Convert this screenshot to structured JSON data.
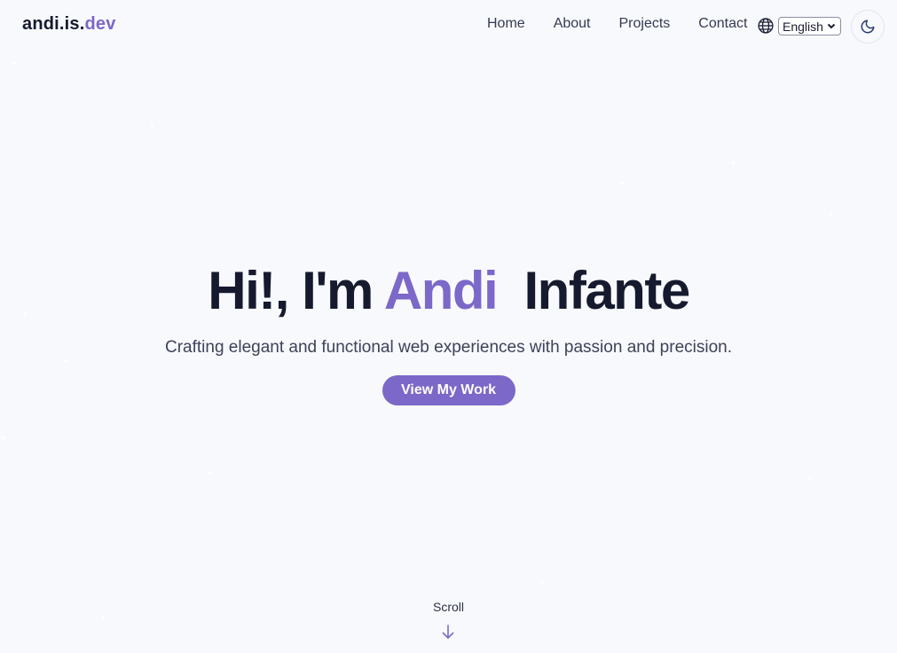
{
  "header": {
    "logo_main": "andi.is.",
    "logo_accent": "dev",
    "nav": [
      {
        "label": "Home"
      },
      {
        "label": "About"
      },
      {
        "label": "Projects"
      },
      {
        "label": "Contact"
      }
    ],
    "language": {
      "icon": "globe-icon",
      "selected": "English"
    },
    "theme_toggle": {
      "icon": "moon-icon"
    }
  },
  "hero": {
    "greeting": "Hi!, I'm",
    "first_name": "Andi",
    "last_name": "Infante",
    "subtitle": "Crafting elegant and functional web experiences with passion and precision.",
    "cta_label": "View My Work"
  },
  "scroll": {
    "label": "Scroll",
    "icon": "arrow-down-icon"
  },
  "colors": {
    "background": "#f8f9fc",
    "accent": "#7b68c8",
    "text": "#151a2e"
  }
}
